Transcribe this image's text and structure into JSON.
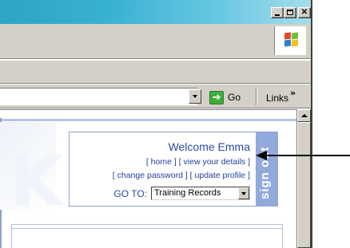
{
  "window": {
    "controls": {
      "minimize": "",
      "maximize": "",
      "close": "✕"
    }
  },
  "address_bar": {
    "go_label": "Go",
    "links_label": "Links",
    "links_chevron": "»"
  },
  "account_panel": {
    "welcome_text": "Welcome Emma",
    "links_row1": {
      "home": "home",
      "view_details": "view your details"
    },
    "links_row2": {
      "change_password": "change password",
      "update_profile": "update profile"
    },
    "goto_label": "GO TO:",
    "goto_selected": "Training Records",
    "signout_label": "sign out"
  },
  "colors": {
    "titlebar": "#39b1d3",
    "panel_text": "#2c49a6",
    "signout_bg": "#92a9db",
    "chrome": "#d4d0c8"
  },
  "icons": [
    "minimize-icon",
    "maximize-icon",
    "close-icon",
    "windows-flag-icon",
    "go-arrow-icon",
    "dropdown-arrow-icon",
    "scroll-up-arrow-icon",
    "annotation-arrow-icon"
  ]
}
